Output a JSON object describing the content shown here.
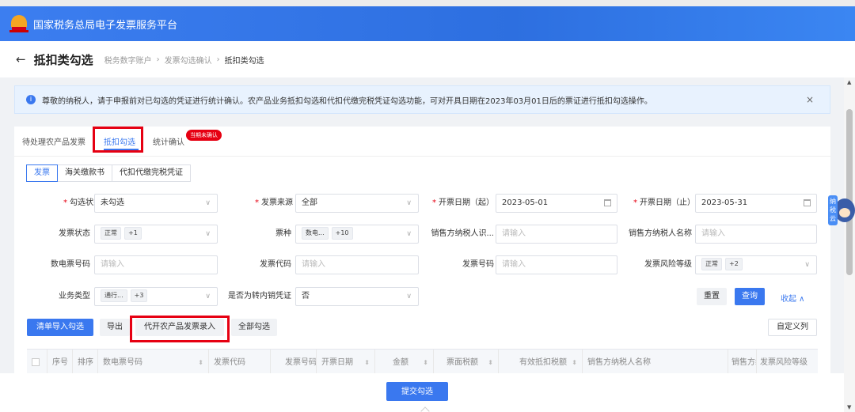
{
  "header": {
    "title": "国家税务总局电子发票服务平台"
  },
  "titlebar": {
    "title": "抵扣类勾选",
    "breadcrumbs": [
      "税务数字账户",
      "发票勾选确认",
      "抵扣类勾选"
    ],
    "separator": "›"
  },
  "notice": {
    "icon": "i",
    "text": "尊敬的纳税人，请于申报前对已勾选的凭证进行统计确认。农产品业务抵扣勾选和代扣代缴完税凭证勾选功能，可对开具日期在2023年03月01日后的票证进行抵扣勾选操作。",
    "close": "×"
  },
  "tabs": {
    "items": [
      "待处理农产品发票",
      "抵扣勾选",
      "统计确认"
    ],
    "badge": "当期未确认"
  },
  "subtabs": [
    "发票",
    "海关缴款书",
    "代扣代缴完税凭证"
  ],
  "form": {
    "check_status": {
      "label": "勾选状态",
      "value": "未勾选"
    },
    "invoice_source": {
      "label": "发票来源",
      "value": "全部"
    },
    "date_start": {
      "label": "开票日期（起）",
      "value": "2023-05-01"
    },
    "date_end": {
      "label": "开票日期（止）",
      "value": "2023-05-31"
    },
    "invoice_status": {
      "label": "发票状态",
      "tags": [
        "正常",
        "+1"
      ]
    },
    "ticket_type": {
      "label": "票种",
      "tags": [
        "数电...",
        "+10"
      ]
    },
    "seller_tax_id": {
      "label": "销售方纳税人识...",
      "placeholder": "请输入"
    },
    "seller_name": {
      "label": "销售方纳税人名称",
      "placeholder": "请输入"
    },
    "digital_no": {
      "label": "数电票号码",
      "placeholder": "请输入"
    },
    "invoice_code": {
      "label": "发票代码",
      "placeholder": "请输入"
    },
    "invoice_no": {
      "label": "发票号码",
      "placeholder": "请输入"
    },
    "risk_level": {
      "label": "发票风险等级",
      "tags": [
        "正常",
        "+2"
      ]
    },
    "biz_type": {
      "label": "业务类型",
      "tags": [
        "通行...",
        "+3"
      ]
    },
    "transfer": {
      "label": "是否为转内销凭证",
      "value": "否"
    }
  },
  "actions": {
    "reset": "重置",
    "query": "查询",
    "collapse": "收起 ∧"
  },
  "toolbar": {
    "import": "清单导入勾选",
    "export": "导出",
    "agri_entry": "代开农产品发票录入",
    "select_all": "全部勾选",
    "custom_columns": "自定义列"
  },
  "table": {
    "columns": [
      "序号",
      "排序",
      "数电票号码",
      "发票代码",
      "发票号码",
      "开票日期",
      "金额",
      "票面税额",
      "有效抵扣税额",
      "销售方纳税人名称",
      "销售方纳",
      "发票风险等级"
    ],
    "sort_glyph": "⬍"
  },
  "footer": {
    "submit": "提交勾选"
  },
  "assistant": {
    "sign": "纳\n税\n云"
  },
  "colors": {
    "primary": "#3a78ef",
    "highlight": "#e60012",
    "header": "#2d6fe0"
  },
  "icons": [
    "logo-emblem-icon",
    "back-arrow-icon",
    "info-icon",
    "close-icon",
    "chevron-down-icon",
    "calendar-icon",
    "sort-icon",
    "checkbox-icon",
    "scroll-up-icon",
    "scroll-down-icon",
    "assistant-avatar-icon"
  ]
}
